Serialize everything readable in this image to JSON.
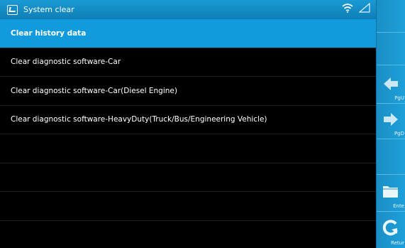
{
  "window": {
    "title": "System clear",
    "icon": "app-icon",
    "status_icons": [
      "wifi-icon",
      "signal-icon"
    ]
  },
  "list": {
    "items": [
      {
        "label": "Clear history data",
        "selected": true
      },
      {
        "label": "Clear diagnostic software-Car",
        "selected": false
      },
      {
        "label": "Clear diagnostic software-Car(Diesel Engine)",
        "selected": false
      },
      {
        "label": "Clear diagnostic software-HeavyDuty(Truck/Bus/Engineering Vehicle)",
        "selected": false
      },
      {
        "label": "",
        "selected": false
      },
      {
        "label": "",
        "selected": false
      },
      {
        "label": "",
        "selected": false
      },
      {
        "label": "",
        "selected": false
      }
    ]
  },
  "side_panel": {
    "page_up_label": "PgU",
    "page_down_label": "PgD",
    "enter_label": "Ente",
    "return_label": "Retur"
  },
  "colors": {
    "accent": "#129bdc",
    "titlebar": "#1a9ad4",
    "background": "#000000"
  }
}
